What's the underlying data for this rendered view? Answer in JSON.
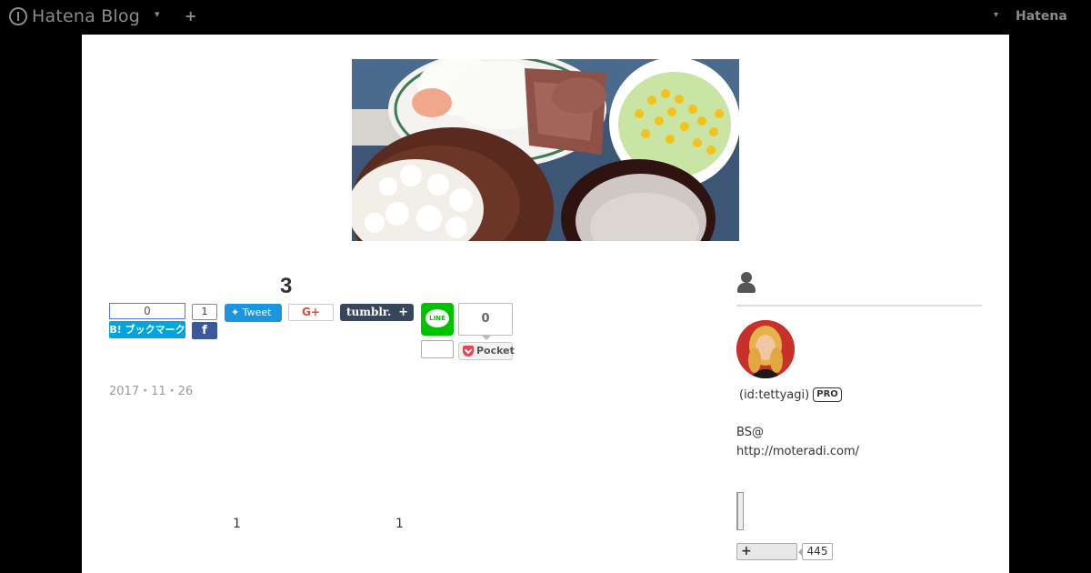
{
  "globalbar": {
    "logo_text": "Hatena Blog",
    "menu_caret": "▾",
    "add_label": "+",
    "right_caret": "▾",
    "hatena_label": "Hatena",
    "bg_color": "#000000",
    "text_color": "#8a8a8a"
  },
  "header": {
    "image_alt": "food photo header"
  },
  "entry": {
    "title": "3",
    "date": "2017・11・26",
    "body_numbers": [
      "1",
      "1"
    ]
  },
  "share": {
    "hatena_bookmark_count": "0",
    "hatena_bookmark_label": "B! ブックマーク",
    "facebook_count": "1",
    "facebook_icon": "f",
    "tweet_label": "Tweet",
    "googleplus_label": "G+",
    "tumblr_label": "tumblr.",
    "tumblr_plus": "+",
    "line_label": "LINE",
    "pocket_count": "0",
    "pocket_label": "Pocket",
    "colors": {
      "hatena": "#00a4de",
      "facebook": "#3b5998",
      "twitter": "#1b95e0",
      "googleplus": "#dd4b39",
      "tumblr": "#36465d",
      "line": "#00c300",
      "pocket": "#ee4056"
    }
  },
  "sidebar": {
    "user_icon": "user-icon",
    "user_id": "(id:tettyagi)",
    "pro_badge": "PRO",
    "description_line1": "BS@",
    "description_link": "http://moteradi.com/",
    "follow_label": "+",
    "follow_count": "445"
  }
}
